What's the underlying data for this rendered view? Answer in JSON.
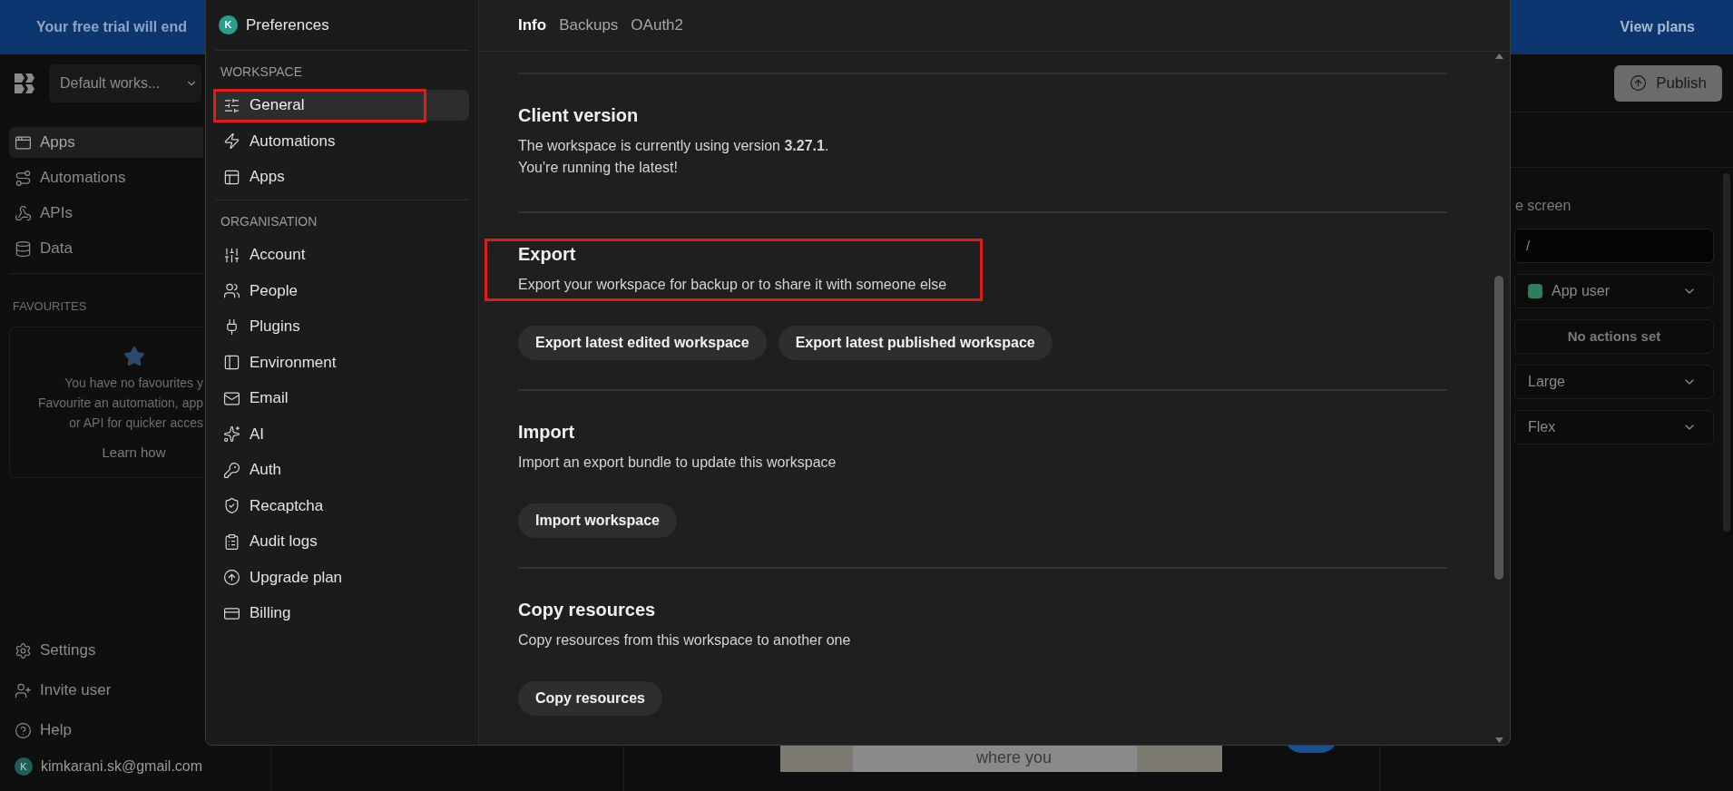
{
  "banner": {
    "message": "Your free trial will end",
    "action": "View plans"
  },
  "app": {
    "workspace_selector": "Default works...",
    "nav": [
      {
        "label": "Apps",
        "selected": true
      },
      {
        "label": "Automations",
        "selected": false
      },
      {
        "label": "APIs",
        "selected": false
      },
      {
        "label": "Data",
        "selected": false
      }
    ],
    "favourites": {
      "heading": "FAVOURITES",
      "lines": [
        "You have no favourites y",
        "Favourite an automation, app",
        "or API for quicker acces"
      ],
      "link": "Learn how"
    },
    "footer": [
      "Settings",
      "Invite user",
      "Help"
    ],
    "user": {
      "initial": "K",
      "email": "kimkarani.sk@gmail.com"
    }
  },
  "toolbar": {
    "publish": "Publish"
  },
  "properties": {
    "label": "e screen",
    "route_value": "/",
    "role": {
      "text": "App user",
      "color": "#2e7d5b"
    },
    "actions": "No actions set",
    "selects": [
      "Large",
      "Flex"
    ]
  },
  "canvas": {
    "preview_text": "where you"
  },
  "preferences": {
    "avatar": "K",
    "title": "Preferences",
    "groups": [
      {
        "heading": "WORKSPACE",
        "items": [
          {
            "label": "General",
            "selected": true,
            "highlighted": true
          },
          {
            "label": "Automations",
            "selected": false,
            "highlighted": false
          },
          {
            "label": "Apps",
            "selected": false,
            "highlighted": false
          }
        ]
      },
      {
        "heading": "ORGANISATION",
        "items": [
          {
            "label": "Account",
            "selected": false,
            "highlighted": false
          },
          {
            "label": "People",
            "selected": false,
            "highlighted": false
          },
          {
            "label": "Plugins",
            "selected": false,
            "highlighted": false
          },
          {
            "label": "Environment",
            "selected": false,
            "highlighted": false
          },
          {
            "label": "Email",
            "selected": false,
            "highlighted": false
          },
          {
            "label": "AI",
            "selected": false,
            "highlighted": false
          },
          {
            "label": "Auth",
            "selected": false,
            "highlighted": false
          },
          {
            "label": "Recaptcha",
            "selected": false,
            "highlighted": false
          },
          {
            "label": "Audit logs",
            "selected": false,
            "highlighted": false
          },
          {
            "label": "Upgrade plan",
            "selected": false,
            "highlighted": false
          },
          {
            "label": "Billing",
            "selected": false,
            "highlighted": false
          }
        ]
      }
    ],
    "tabs": [
      {
        "label": "Info",
        "selected": true
      },
      {
        "label": "Backups",
        "selected": false
      },
      {
        "label": "OAuth2",
        "selected": false
      }
    ],
    "sections": [
      {
        "heading": "Client version",
        "lines": [
          "The workspace is currently using version **3.27.1**.",
          "You're running the latest!"
        ],
        "highlighted": false
      },
      {
        "heading": "Export",
        "lines": [
          "Export your workspace for backup or to share it with someone else"
        ],
        "buttons": [
          "Export latest edited workspace",
          "Export latest published workspace"
        ],
        "highlighted": true
      },
      {
        "heading": "Import",
        "lines": [
          "Import an export bundle to update this workspace"
        ],
        "buttons": [
          "Import workspace"
        ],
        "highlighted": false
      },
      {
        "heading": "Copy resources",
        "lines": [
          "Copy resources from this workspace to another one"
        ],
        "buttons": [
          "Copy resources"
        ],
        "highlighted": false
      }
    ]
  }
}
